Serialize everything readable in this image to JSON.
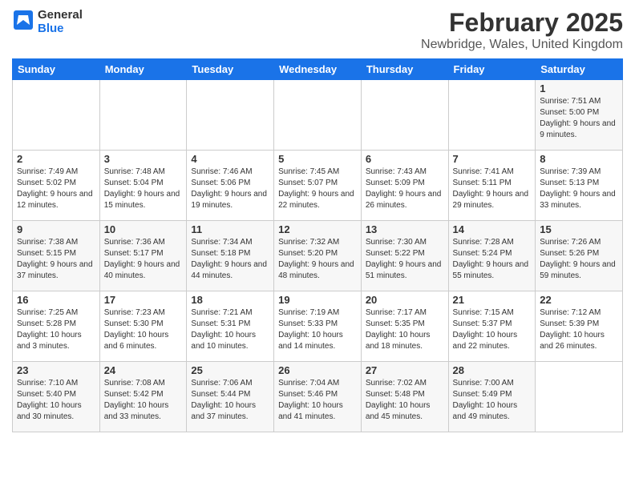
{
  "header": {
    "title": "February 2025",
    "subtitle": "Newbridge, Wales, United Kingdom",
    "logo_line1": "General",
    "logo_line2": "Blue"
  },
  "days_of_week": [
    "Sunday",
    "Monday",
    "Tuesday",
    "Wednesday",
    "Thursday",
    "Friday",
    "Saturday"
  ],
  "weeks": [
    [
      {
        "day": "",
        "info": ""
      },
      {
        "day": "",
        "info": ""
      },
      {
        "day": "",
        "info": ""
      },
      {
        "day": "",
        "info": ""
      },
      {
        "day": "",
        "info": ""
      },
      {
        "day": "",
        "info": ""
      },
      {
        "day": "1",
        "info": "Sunrise: 7:51 AM\nSunset: 5:00 PM\nDaylight: 9 hours and 9 minutes."
      }
    ],
    [
      {
        "day": "2",
        "info": "Sunrise: 7:49 AM\nSunset: 5:02 PM\nDaylight: 9 hours and 12 minutes."
      },
      {
        "day": "3",
        "info": "Sunrise: 7:48 AM\nSunset: 5:04 PM\nDaylight: 9 hours and 15 minutes."
      },
      {
        "day": "4",
        "info": "Sunrise: 7:46 AM\nSunset: 5:06 PM\nDaylight: 9 hours and 19 minutes."
      },
      {
        "day": "5",
        "info": "Sunrise: 7:45 AM\nSunset: 5:07 PM\nDaylight: 9 hours and 22 minutes."
      },
      {
        "day": "6",
        "info": "Sunrise: 7:43 AM\nSunset: 5:09 PM\nDaylight: 9 hours and 26 minutes."
      },
      {
        "day": "7",
        "info": "Sunrise: 7:41 AM\nSunset: 5:11 PM\nDaylight: 9 hours and 29 minutes."
      },
      {
        "day": "8",
        "info": "Sunrise: 7:39 AM\nSunset: 5:13 PM\nDaylight: 9 hours and 33 minutes."
      }
    ],
    [
      {
        "day": "9",
        "info": "Sunrise: 7:38 AM\nSunset: 5:15 PM\nDaylight: 9 hours and 37 minutes."
      },
      {
        "day": "10",
        "info": "Sunrise: 7:36 AM\nSunset: 5:17 PM\nDaylight: 9 hours and 40 minutes."
      },
      {
        "day": "11",
        "info": "Sunrise: 7:34 AM\nSunset: 5:18 PM\nDaylight: 9 hours and 44 minutes."
      },
      {
        "day": "12",
        "info": "Sunrise: 7:32 AM\nSunset: 5:20 PM\nDaylight: 9 hours and 48 minutes."
      },
      {
        "day": "13",
        "info": "Sunrise: 7:30 AM\nSunset: 5:22 PM\nDaylight: 9 hours and 51 minutes."
      },
      {
        "day": "14",
        "info": "Sunrise: 7:28 AM\nSunset: 5:24 PM\nDaylight: 9 hours and 55 minutes."
      },
      {
        "day": "15",
        "info": "Sunrise: 7:26 AM\nSunset: 5:26 PM\nDaylight: 9 hours and 59 minutes."
      }
    ],
    [
      {
        "day": "16",
        "info": "Sunrise: 7:25 AM\nSunset: 5:28 PM\nDaylight: 10 hours and 3 minutes."
      },
      {
        "day": "17",
        "info": "Sunrise: 7:23 AM\nSunset: 5:30 PM\nDaylight: 10 hours and 6 minutes."
      },
      {
        "day": "18",
        "info": "Sunrise: 7:21 AM\nSunset: 5:31 PM\nDaylight: 10 hours and 10 minutes."
      },
      {
        "day": "19",
        "info": "Sunrise: 7:19 AM\nSunset: 5:33 PM\nDaylight: 10 hours and 14 minutes."
      },
      {
        "day": "20",
        "info": "Sunrise: 7:17 AM\nSunset: 5:35 PM\nDaylight: 10 hours and 18 minutes."
      },
      {
        "day": "21",
        "info": "Sunrise: 7:15 AM\nSunset: 5:37 PM\nDaylight: 10 hours and 22 minutes."
      },
      {
        "day": "22",
        "info": "Sunrise: 7:12 AM\nSunset: 5:39 PM\nDaylight: 10 hours and 26 minutes."
      }
    ],
    [
      {
        "day": "23",
        "info": "Sunrise: 7:10 AM\nSunset: 5:40 PM\nDaylight: 10 hours and 30 minutes."
      },
      {
        "day": "24",
        "info": "Sunrise: 7:08 AM\nSunset: 5:42 PM\nDaylight: 10 hours and 33 minutes."
      },
      {
        "day": "25",
        "info": "Sunrise: 7:06 AM\nSunset: 5:44 PM\nDaylight: 10 hours and 37 minutes."
      },
      {
        "day": "26",
        "info": "Sunrise: 7:04 AM\nSunset: 5:46 PM\nDaylight: 10 hours and 41 minutes."
      },
      {
        "day": "27",
        "info": "Sunrise: 7:02 AM\nSunset: 5:48 PM\nDaylight: 10 hours and 45 minutes."
      },
      {
        "day": "28",
        "info": "Sunrise: 7:00 AM\nSunset: 5:49 PM\nDaylight: 10 hours and 49 minutes."
      },
      {
        "day": "",
        "info": ""
      }
    ]
  ]
}
